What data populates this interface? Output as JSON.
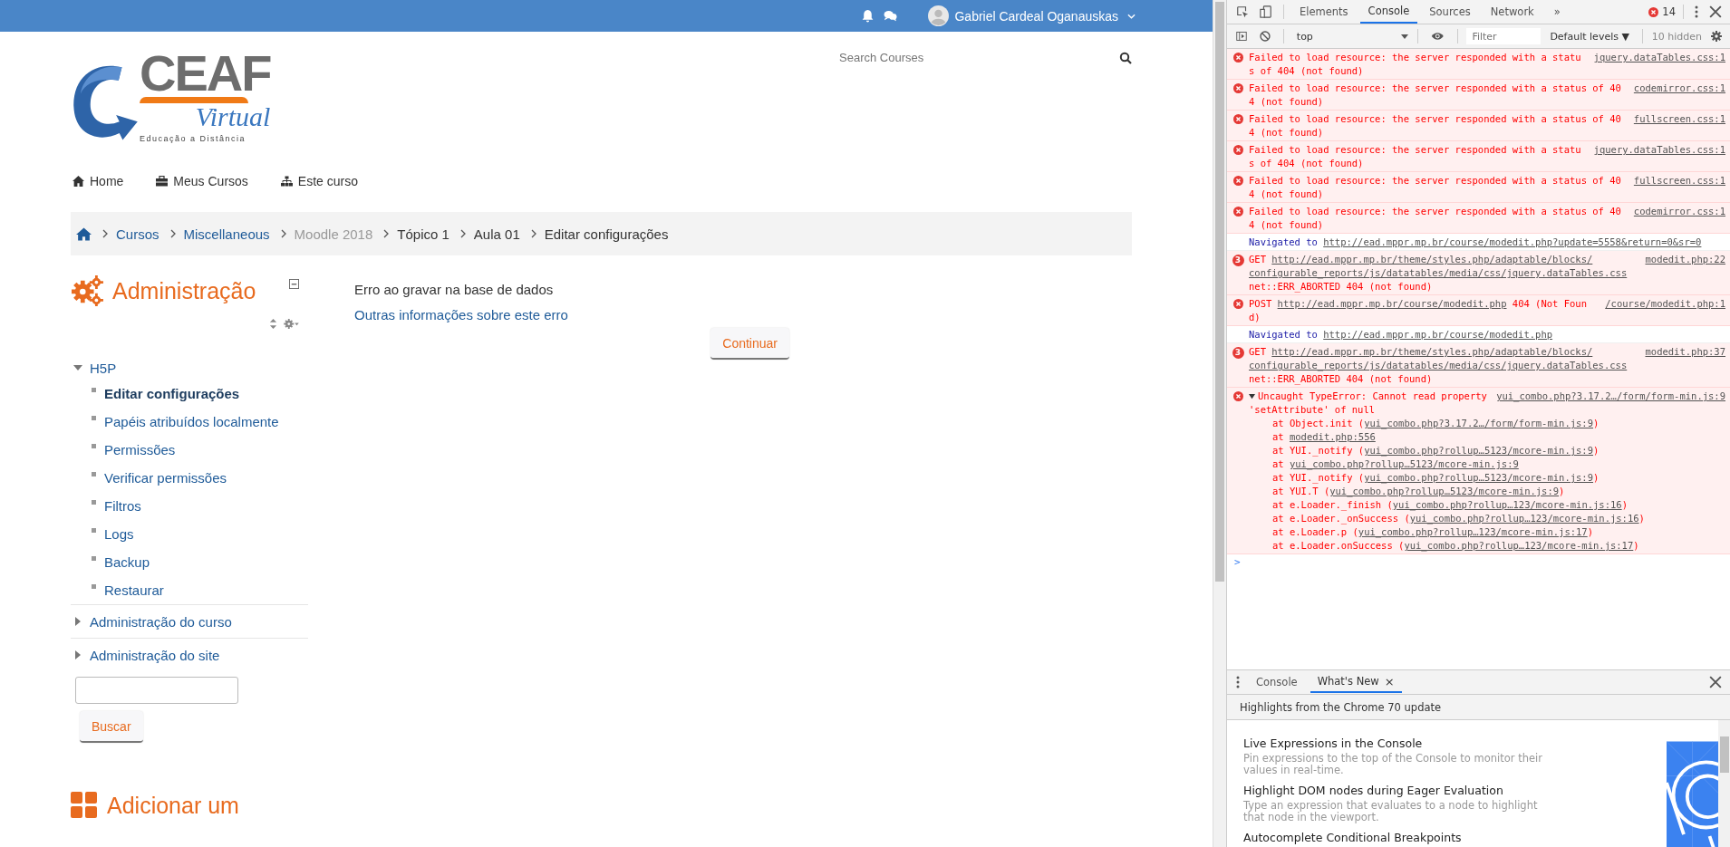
{
  "topbar": {
    "user_name": "Gabriel Cardeal Oganauskas"
  },
  "logo": {
    "title": "CEAF",
    "subtitle": "Virtual",
    "tagline": "Educação a Distância"
  },
  "search": {
    "placeholder": "Search Courses"
  },
  "nav": [
    {
      "label": "Home"
    },
    {
      "label": "Meus Cursos"
    },
    {
      "label": "Este curso"
    }
  ],
  "breadcrumb": [
    {
      "label": "Cursos",
      "kind": "link"
    },
    {
      "label": "Miscellaneous",
      "kind": "link"
    },
    {
      "label": "Moodle 2018",
      "kind": "dimmed"
    },
    {
      "label": "Tópico 1",
      "kind": "plain"
    },
    {
      "label": "Aula 01",
      "kind": "plain"
    },
    {
      "label": "Editar configurações",
      "kind": "plain"
    }
  ],
  "admin": {
    "title": "Administração",
    "tree": [
      {
        "label": "H5P",
        "expanded": true,
        "children": [
          {
            "label": "Editar configurações",
            "selected": true
          },
          {
            "label": "Papéis atribuídos localmente",
            "selected": false
          },
          {
            "label": "Permissões",
            "selected": false
          },
          {
            "label": "Verificar permissões",
            "selected": false
          },
          {
            "label": "Filtros",
            "selected": false
          },
          {
            "label": "Logs",
            "selected": false
          },
          {
            "label": "Backup",
            "selected": false
          },
          {
            "label": "Restaurar",
            "selected": false
          }
        ]
      },
      {
        "label": "Administração do curso",
        "expanded": false
      },
      {
        "label": "Administração do site",
        "expanded": false
      }
    ],
    "search_button": "Buscar"
  },
  "next_block": {
    "title": "Adicionar um"
  },
  "error": {
    "message": "Erro ao gravar na base de dados",
    "more_link": "Outras informações sobre este erro",
    "button": "Continuar"
  },
  "devtools": {
    "tabs": [
      {
        "label": "Elements",
        "selected": false
      },
      {
        "label": "Console",
        "selected": true
      },
      {
        "label": "Sources",
        "selected": false
      },
      {
        "label": "Network",
        "selected": false
      }
    ],
    "more_tabs": "»",
    "error_count": "14",
    "context": "top",
    "filter_placeholder": "Filter",
    "levels": "Default levels ▼",
    "hidden": "10 hidden",
    "messages": [
      {
        "kind": "error",
        "source": "jquery.dataTables.css:1",
        "segments": [
          {
            "text": "Failed to load resource: the server responded with a status of 404 (not found)",
            "link": false
          }
        ]
      },
      {
        "kind": "error",
        "source": "codemirror.css:1",
        "segments": [
          {
            "text": "Failed to load resource: the server responded with a status of 404 (not found)",
            "link": false
          }
        ]
      },
      {
        "kind": "error",
        "source": "fullscreen.css:1",
        "segments": [
          {
            "text": "Failed to load resource: the server responded with a status of 404 (not found)",
            "link": false
          }
        ]
      },
      {
        "kind": "error",
        "source": "jquery.dataTables.css:1",
        "segments": [
          {
            "text": "Failed to load resource: the server responded with a status of 404 (not found)",
            "link": false
          }
        ]
      },
      {
        "kind": "error",
        "source": "fullscreen.css:1",
        "segments": [
          {
            "text": "Failed to load resource: the server responded with a status of 404 (not found)",
            "link": false
          }
        ]
      },
      {
        "kind": "error",
        "source": "codemirror.css:1",
        "segments": [
          {
            "text": "Failed to load resource: the server responded with a status of 404 (not found)",
            "link": false
          }
        ]
      },
      {
        "kind": "info",
        "segments": [
          {
            "text": "Navigated to ",
            "link": false
          },
          {
            "text": "http://ead.mppr.mp.br/course/modedit.php?update=5558&return=0&sr=0",
            "link": true
          }
        ]
      },
      {
        "kind": "error",
        "count": "3",
        "source": "modedit.php:22",
        "segments": [
          {
            "text": "GET ",
            "link": false
          },
          {
            "text": "http://ead.mppr.mp.br/theme/styles.php/adaptable/blocks/",
            "link": true
          },
          {
            "text": "configurable_reports/js/datatables/media/css/jquery.dataTables.css",
            "link": true
          },
          {
            "text": " net::ERR_ABORTED 404 (not found)",
            "link": false
          }
        ]
      },
      {
        "kind": "error",
        "source": "/course/modedit.php:1",
        "segments": [
          {
            "text": "POST ",
            "link": false
          },
          {
            "text": "http://ead.mppr.mp.br/course/modedit.php",
            "link": true
          },
          {
            "text": " 404 (Not Found)",
            "link": false
          }
        ]
      },
      {
        "kind": "info",
        "segments": [
          {
            "text": "Navigated to ",
            "link": false
          },
          {
            "text": "http://ead.mppr.mp.br/course/modedit.php",
            "link": true
          }
        ]
      },
      {
        "kind": "error",
        "count": "3",
        "source": "modedit.php:37",
        "segments": [
          {
            "text": "GET ",
            "link": false
          },
          {
            "text": "http://ead.mppr.mp.br/theme/styles.php/adaptable/blocks/",
            "link": true
          },
          {
            "text": "configurable_reports/js/datatables/media/css/jquery.dataTables.css",
            "link": true
          },
          {
            "text": " net::ERR_ABORTED 404 (not found)",
            "link": false
          }
        ]
      },
      {
        "kind": "exception",
        "expanded": true,
        "source": "yui_combo.php?3.17.2…/form/form-min.js:9",
        "segments": [
          {
            "text": "Uncaught TypeError: Cannot read property 'setAttribute' of null",
            "link": false
          }
        ],
        "stack": [
          {
            "call": "at Object.init (",
            "url": "yui_combo.php?3.17.2…/form/form-min.js:9",
            "close": ")"
          },
          {
            "call": "at ",
            "url": "modedit.php:556"
          },
          {
            "call": "at YUI._notify (",
            "url": "yui_combo.php?rollup…5123/mcore-min.js:9",
            "close": ")"
          },
          {
            "call": "at ",
            "url": "yui_combo.php?rollup…5123/mcore-min.js:9"
          },
          {
            "call": "at YUI._notify (",
            "url": "yui_combo.php?rollup…5123/mcore-min.js:9",
            "close": ")"
          },
          {
            "call": "at YUI.T (",
            "url": "yui_combo.php?rollup…5123/mcore-min.js:9",
            "close": ")"
          },
          {
            "call": "at e.Loader._finish (",
            "url": "yui_combo.php?rollup…123/mcore-min.js:16",
            "close": ")"
          },
          {
            "call": "at e.Loader._onSuccess (",
            "url": "yui_combo.php?rollup…123/mcore-min.js:16",
            "close": ")"
          },
          {
            "call": "at e.Loader.p (",
            "url": "yui_combo.php?rollup…123/mcore-min.js:17",
            "close": ")"
          },
          {
            "call": "at e.Loader.onSuccess (",
            "url": "yui_combo.php?rollup…123/mcore-min.js:17",
            "close": ")"
          }
        ]
      }
    ],
    "prompt": ">",
    "drawer": {
      "tabs": [
        {
          "label": "Console",
          "selected": false,
          "closable": false
        },
        {
          "label": "What's New",
          "selected": true,
          "closable": true
        }
      ],
      "close_glyph": "×",
      "heading": "Highlights from the Chrome 70 update",
      "articles": [
        {
          "title": "Live Expressions in the Console",
          "description": "Pin expressions to the top of the Console to monitor their values in real-time."
        },
        {
          "title": "Highlight DOM nodes during Eager Evaluation",
          "description": "Type an expression that evaluates to a node to highlight that node in the viewport."
        },
        {
          "title": "Autocomplete Conditional Breakpoints"
        }
      ]
    }
  }
}
